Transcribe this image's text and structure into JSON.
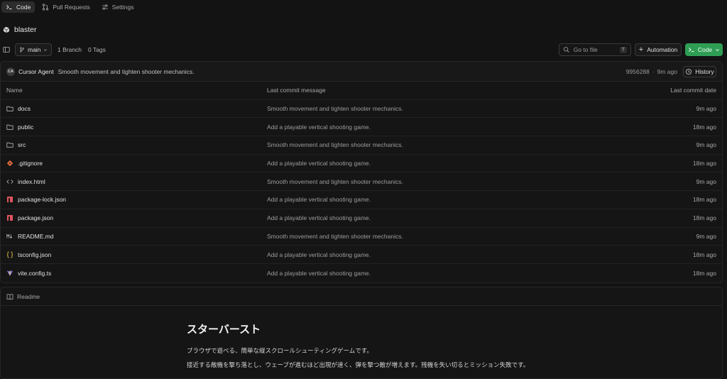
{
  "tabs": [
    {
      "label": "Code",
      "active": true
    },
    {
      "label": "Pull Requests",
      "active": false
    },
    {
      "label": "Settings",
      "active": false
    }
  ],
  "repo": {
    "name": "blaster"
  },
  "toolbar": {
    "branch": "main",
    "branch_count": "1 Branch",
    "tag_count": "0 Tags",
    "goto_placeholder": "Go to file",
    "goto_shortcut": "T",
    "automation_label": "Automation",
    "code_label": "Code"
  },
  "latest_commit": {
    "avatar": "CA",
    "author": "Cursor Agent",
    "message": "Smooth movement and tighten shooter mechanics.",
    "hash": "9956288",
    "sep": "·",
    "time": "9m ago",
    "history_label": "History"
  },
  "table": {
    "headers": {
      "name": "Name",
      "message": "Last commit message",
      "date": "Last commit date"
    },
    "rows": [
      {
        "name": "docs",
        "icon": "folder-icon",
        "message": "Smooth movement and tighten shooter mechanics.",
        "date": "9m ago"
      },
      {
        "name": "public",
        "icon": "folder-icon",
        "message": "Add a playable vertical shooting game.",
        "date": "18m ago"
      },
      {
        "name": "src",
        "icon": "folder-icon",
        "message": "Smooth movement and tighten shooter mechanics.",
        "date": "9m ago"
      },
      {
        "name": ".gitignore",
        "icon": "git-icon",
        "message": "Add a playable vertical shooting game.",
        "date": "18m ago"
      },
      {
        "name": "index.html",
        "icon": "code-file-icon",
        "message": "Smooth movement and tighten shooter mechanics.",
        "date": "9m ago"
      },
      {
        "name": "package-lock.json",
        "icon": "npm-icon",
        "message": "Add a playable vertical shooting game.",
        "date": "18m ago"
      },
      {
        "name": "package.json",
        "icon": "npm-icon",
        "message": "Add a playable vertical shooting game.",
        "date": "18m ago"
      },
      {
        "name": "README.md",
        "icon": "markdown-icon",
        "message": "Smooth movement and tighten shooter mechanics.",
        "date": "9m ago"
      },
      {
        "name": "tsconfig.json",
        "icon": "json-icon",
        "message": "Add a playable vertical shooting game.",
        "date": "18m ago"
      },
      {
        "name": "vite.config.ts",
        "icon": "vite-icon",
        "message": "Add a playable vertical shooting game.",
        "date": "18m ago"
      }
    ]
  },
  "readme": {
    "label": "Readme",
    "title": "スターバースト",
    "paragraphs": [
      "ブラウザで遊べる、簡単な縦スクロールシューティングゲームです。",
      "接近する敵機を撃ち落とし、ウェーブが進むほど出現が速く、弾を撃つ敵が増えます。残機を失い切るとミッション失敗です。"
    ]
  },
  "colors": {
    "accent_green": "#2f9e55",
    "background": "#131313",
    "git_icon": "#e0683f",
    "npm_icon": "#e0555f",
    "json_icon": "#d9b44a",
    "vite_icon": "#8d7cf0"
  }
}
